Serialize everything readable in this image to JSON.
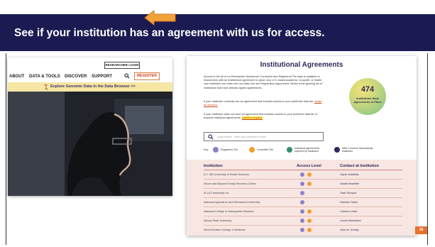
{
  "slide": {
    "title": "See if your institution has an agreement with us for access.",
    "page_number": "38"
  },
  "colors": {
    "banner": "#1b1b52",
    "accent": "#e9702e",
    "register_text": "#c9401d",
    "genomic_bar": "#f6e6a4",
    "table_bg": "#f8e6e2",
    "badge_start": "#f2e277",
    "badge_end": "#79c48a"
  },
  "left_screenshot": {
    "login_button": "RESEARCHER LOGIN",
    "nav": {
      "items": [
        "ABOUT",
        "DATA & TOOLS",
        "DISCOVER",
        "SUPPORT"
      ],
      "search_icon": "search-icon",
      "register": "REGISTER"
    },
    "arrow_icon": "arrow-left-icon",
    "banner_text": "Explore Genomic Data in the Data Browser >>",
    "banner_icon": "dna-icon"
  },
  "right_screenshot": {
    "title": "Institutional Agreements",
    "para1": "Access to the All of Us Researcher Workbench Controlled and Registered Tier data is available to researchers with an institutional agreement in place. Any U.S.-based academic, nonprofit, or health care institution can enter into our Data Use and Registration Agreement. Below is the growing list of institutions that have already signed agreements.",
    "para2_prefix": "If your institution currently has an agreement that includes access to your preferred data tier,",
    "para2_link": "create an account.",
    "para3_prefix": "If your institution does not have an agreement that includes access to your preferred data tier or requires individual agreements,",
    "para3_link": "submit a request.",
    "badge": {
      "number": "474",
      "label": "Institutions Have Agreements in Place"
    },
    "search": {
      "placeholder": "Quick search - enter your institution's name"
    },
    "key": {
      "label": "Key:",
      "items": [
        {
          "label": "Registered Tier",
          "color": "#8c82c7"
        },
        {
          "label": "Controlled Tier",
          "color": "#f0a02c"
        },
        {
          "label": "Individual agreements required by institution",
          "color": "#2f8f6a"
        },
        {
          "label": "With Common Stewardship institution",
          "color": "#2b2a5c"
        }
      ]
    },
    "table": {
      "headers": [
        "Institution",
        "Access Level",
        "Contact at Institution"
      ],
      "rows": [
        {
          "institution": "A.T. Still University of Health Sciences",
          "contact": "Gayle Gubitlidis"
        },
        {
          "institution": "Above and Beyond Family Recovery Center",
          "contact": "Daniel Hostetler"
        },
        {
          "institution": "Al-LA Community Inc",
          "contact": "Todd Tenuyzz"
        },
        {
          "institution": "Alabama Agriculture and Mechanical University",
          "contact": "Damian Clarke"
        },
        {
          "institution": "Alabama College of Osteopathic Medicine",
          "contact": "Carmen Lewis"
        },
        {
          "institution": "Albany State University",
          "contact": "Louise Brinesford"
        },
        {
          "institution": "Albert Einstein College of Medicine",
          "contact": "John M. Greally"
        }
      ]
    }
  }
}
